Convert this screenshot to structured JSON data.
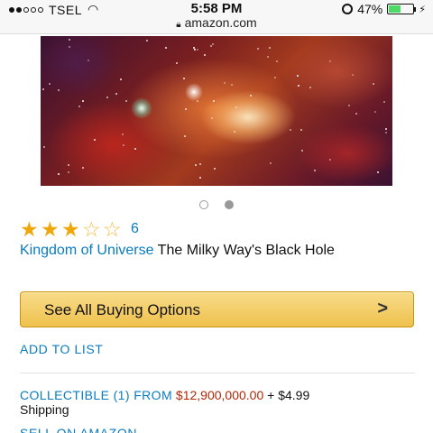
{
  "status_bar": {
    "carrier": "TSEL",
    "time": "5:58 PM",
    "url": "amazon.com",
    "battery": "47%",
    "battery_level": 0.47,
    "signal_bars": 2
  },
  "product": {
    "image_pager": {
      "count": 2,
      "active_index": 1
    },
    "rating": {
      "stars": 3,
      "max": 5,
      "count": "6"
    },
    "brand": "Kingdom of Universe",
    "title": "The Milky Way's Black Hole"
  },
  "actions": {
    "buy_options_label": "See All Buying Options",
    "buy_options_chevron": ">",
    "add_to_list": "ADD TO LIST"
  },
  "offers": {
    "collectible_label": "COLLECTIBLE (1) FROM",
    "collectible_price": "$12,900,000.00",
    "shipping_extra": "+ $4.99",
    "shipping_word": "Shipping",
    "sell_on_amazon": "SELL ON AMAZON"
  },
  "colors": {
    "link_blue": "#0a7bbf",
    "star_gold": "#f0a70a",
    "price_red": "#b12704",
    "button_yellow": "#f0c14b"
  },
  "icons": [
    "wifi-icon",
    "lock-icon",
    "rotation-lock-icon",
    "battery-icon",
    "charging-icon",
    "star-icon",
    "chevron-right-icon"
  ]
}
